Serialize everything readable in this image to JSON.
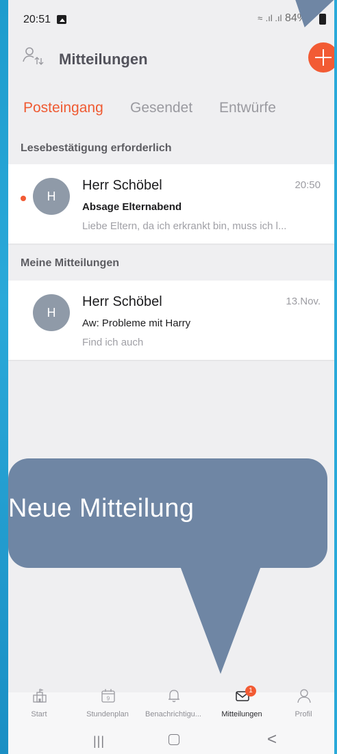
{
  "status": {
    "time": "20:51",
    "battery": "84%"
  },
  "app": {
    "title": "Mitteilungen"
  },
  "tabs": [
    {
      "label": "Posteingang",
      "active": true
    },
    {
      "label": "Gesendet",
      "active": false
    },
    {
      "label": "Entwürfe",
      "active": false
    }
  ],
  "sections": {
    "read_receipt": {
      "title": "Lesebestätigung erforderlich"
    },
    "mine": {
      "title": "Meine Mitteilungen"
    }
  },
  "messages": [
    {
      "initial": "H",
      "sender": "Herr Schöbel",
      "time": "20:50",
      "subject": "Absage Elternabend",
      "preview": "Liebe Eltern, da ich erkrankt bin, muss ich l...",
      "unread": true
    },
    {
      "initial": "H",
      "sender": "Herr Schöbel",
      "time": "13.Nov.",
      "subject": "Aw: Probleme mit Harry",
      "preview": "Find ich auch",
      "unread": false
    }
  ],
  "callout": {
    "text": "Neue Mitteilung"
  },
  "bottom_nav": [
    {
      "label": "Start",
      "icon": "school-icon"
    },
    {
      "label": "Stundenplan",
      "icon": "calendar-icon",
      "day": "9"
    },
    {
      "label": "Benachrichtigu...",
      "icon": "bell-icon"
    },
    {
      "label": "Mitteilungen",
      "icon": "envelope-icon",
      "badge": "1",
      "active": true
    },
    {
      "label": "Profil",
      "icon": "person-icon"
    }
  ],
  "system_nav": {
    "recents": "|||",
    "back": "<"
  },
  "colors": {
    "accent": "#f25b34",
    "callout": "#6f86a4",
    "slide_bg": "#29a6d6"
  }
}
